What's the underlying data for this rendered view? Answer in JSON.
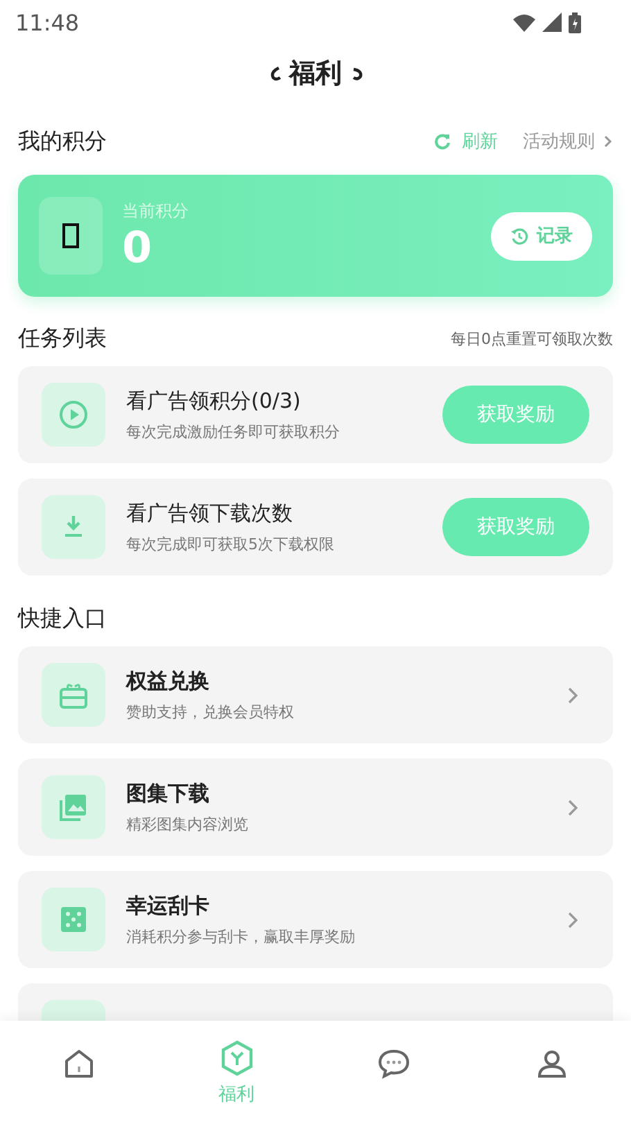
{
  "status_bar": {
    "time": "11:48"
  },
  "header": {
    "title": "福利"
  },
  "points_section": {
    "title": "我的积分",
    "refresh": "刷新",
    "rules": "活动规则"
  },
  "points_card": {
    "label": "当前积分",
    "value": "0",
    "record_button": "记录"
  },
  "tasks_section": {
    "title": "任务列表",
    "note": "每日0点重置可领取次数"
  },
  "tasks": [
    {
      "kind": "play",
      "title": "看广告领积分(0/3)",
      "subtitle": "每次完成激励任务即可获取积分",
      "button": "获取奖励"
    },
    {
      "kind": "download",
      "title": "看广告领下载次数",
      "subtitle": "每次完成即可获取5次下载权限",
      "button": "获取奖励"
    }
  ],
  "shortcuts_section": {
    "title": "快捷入口"
  },
  "shortcuts": [
    {
      "kind": "gift",
      "title": "权益兑换",
      "subtitle": "赞助支持，兑换会员特权"
    },
    {
      "kind": "gallery",
      "title": "图集下载",
      "subtitle": "精彩图集内容浏览"
    },
    {
      "kind": "dice",
      "title": "幸运刮卡",
      "subtitle": "消耗积分参与刮卡，赢取丰厚奖励"
    }
  ],
  "bottom_nav": [
    {
      "kind": "home",
      "selected": false
    },
    {
      "kind": "welfare",
      "label": "福利",
      "selected": true
    },
    {
      "kind": "chat",
      "selected": false
    },
    {
      "kind": "user",
      "selected": false
    }
  ]
}
